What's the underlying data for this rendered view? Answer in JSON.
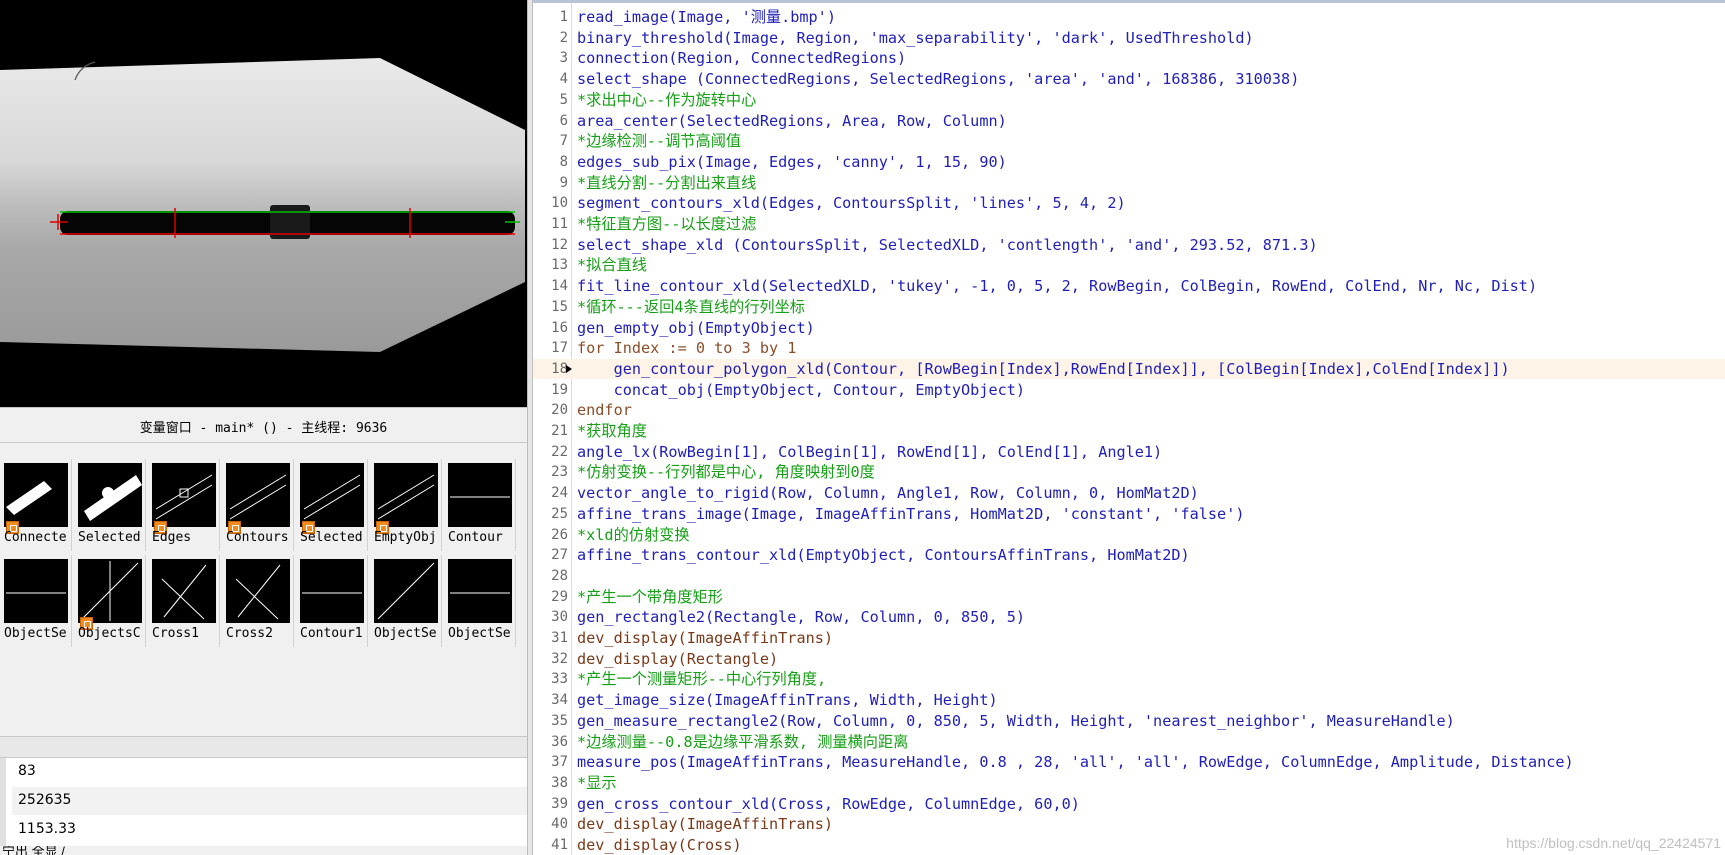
{
  "variable_window": {
    "title": "变量窗口 - main* () - 主线程: 9636",
    "iconic_row1": [
      {
        "label": "Connecte",
        "icon": "region-thumb-icon",
        "badge": true
      },
      {
        "label": "Selected",
        "icon": "region-thumb-icon",
        "badge": false
      },
      {
        "label": "Edges",
        "icon": "edges-thumb-icon",
        "badge": true
      },
      {
        "label": "Contours",
        "icon": "contours-thumb-icon",
        "badge": true
      },
      {
        "label": "Selected",
        "icon": "contours-thumb-icon",
        "badge": true
      },
      {
        "label": "EmptyObj",
        "icon": "contours-thumb-icon",
        "badge": true
      },
      {
        "label": "Contour",
        "icon": "line-thumb-icon",
        "badge": false
      }
    ],
    "iconic_row2": [
      {
        "label": "ObjectSe",
        "icon": "cross-line-thumb-icon",
        "badge": false
      },
      {
        "label": "ObjectsC",
        "icon": "line-thumb-icon",
        "badge": true
      },
      {
        "label": "Cross1",
        "icon": "cross-thumb-icon",
        "badge": false
      },
      {
        "label": "Cross2",
        "icon": "cross-thumb-icon",
        "badge": false
      },
      {
        "label": "Contour1",
        "icon": "line-thumb-icon",
        "badge": false
      },
      {
        "label": "ObjectSe",
        "icon": "line-thumb-icon",
        "badge": false
      },
      {
        "label": "ObjectSe",
        "icon": "line-thumb-icon",
        "badge": false
      }
    ],
    "values": [
      "83",
      "252635",
      "1153.33"
    ],
    "status_text": "宁出  全显 /"
  },
  "code_lines": [
    {
      "n": "1",
      "t": "read_image(Image, '测量.bmp')",
      "k": "op"
    },
    {
      "n": "2",
      "t": "binary_threshold(Image, Region, 'max_separability', 'dark', UsedThreshold)",
      "k": "op"
    },
    {
      "n": "3",
      "t": "connection(Region, ConnectedRegions)",
      "k": "op"
    },
    {
      "n": "4",
      "t": "select_shape (ConnectedRegions, SelectedRegions, 'area', 'and', 168386, 310038)",
      "k": "op"
    },
    {
      "n": "5",
      "t": "*求出中心--作为旋转中心",
      "k": "cm"
    },
    {
      "n": "6",
      "t": "area_center(SelectedRegions, Area, Row, Column)",
      "k": "op"
    },
    {
      "n": "7",
      "t": "*边缘检测--调节高阈值",
      "k": "cm"
    },
    {
      "n": "8",
      "t": "edges_sub_pix(Image, Edges, 'canny', 1, 15, 90)",
      "k": "op"
    },
    {
      "n": "9",
      "t": "*直线分割--分割出来直线",
      "k": "cm"
    },
    {
      "n": "10",
      "t": "segment_contours_xld(Edges, ContoursSplit, 'lines', 5, 4, 2)",
      "k": "op"
    },
    {
      "n": "11",
      "t": "*特征直方图--以长度过滤",
      "k": "cm"
    },
    {
      "n": "12",
      "t": "select_shape_xld (ContoursSplit, SelectedXLD, 'contlength', 'and', 293.52, 871.3)",
      "k": "op"
    },
    {
      "n": "13",
      "t": "*拟合直线",
      "k": "cm"
    },
    {
      "n": "14",
      "t": "fit_line_contour_xld(SelectedXLD, 'tukey', -1, 0, 5, 2, RowBegin, ColBegin, RowEnd, ColEnd, Nr, Nc, Dist)",
      "k": "op"
    },
    {
      "n": "15",
      "t": "*循环---返回4条直线的行列坐标",
      "k": "cm"
    },
    {
      "n": "16",
      "t": "gen_empty_obj(EmptyObject)",
      "k": "op"
    },
    {
      "n": "17",
      "t": "for Index := 0 to 3 by 1",
      "k": "ctl"
    },
    {
      "n": "18",
      "t": "    gen_contour_polygon_xld(Contour, [RowBegin[Index],RowEnd[Index]], [ColBegin[Index],ColEnd[Index]])",
      "k": "op"
    },
    {
      "n": "19",
      "t": "    concat_obj(EmptyObject, Contour, EmptyObject)",
      "k": "op"
    },
    {
      "n": "20",
      "t": "endfor",
      "k": "ctl"
    },
    {
      "n": "21",
      "t": "*获取角度",
      "k": "cm"
    },
    {
      "n": "22",
      "t": "angle_lx(RowBegin[1], ColBegin[1], RowEnd[1], ColEnd[1], Angle1)",
      "k": "op"
    },
    {
      "n": "23",
      "t": "*仿射变换--行列都是中心, 角度映射到0度",
      "k": "cm"
    },
    {
      "n": "24",
      "t": "vector_angle_to_rigid(Row, Column, Angle1, Row, Column, 0, HomMat2D)",
      "k": "op"
    },
    {
      "n": "25",
      "t": "affine_trans_image(Image, ImageAffinTrans, HomMat2D, 'constant', 'false')",
      "k": "op"
    },
    {
      "n": "26",
      "t": "*xld的仿射变换",
      "k": "cm"
    },
    {
      "n": "27",
      "t": "affine_trans_contour_xld(EmptyObject, ContoursAffinTrans, HomMat2D)",
      "k": "op"
    },
    {
      "n": "28",
      "t": "",
      "k": "op"
    },
    {
      "n": "29",
      "t": "*产生一个带角度矩形",
      "k": "cm"
    },
    {
      "n": "30",
      "t": "gen_rectangle2(Rectangle, Row, Column, 0, 850, 5)",
      "k": "op"
    },
    {
      "n": "31",
      "t": "dev_display(ImageAffinTrans)",
      "k": "dev"
    },
    {
      "n": "32",
      "t": "dev_display(Rectangle)",
      "k": "dev"
    },
    {
      "n": "33",
      "t": "*产生一个测量矩形--中心行列角度,",
      "k": "cm"
    },
    {
      "n": "34",
      "t": "get_image_size(ImageAffinTrans, Width, Height)",
      "k": "op"
    },
    {
      "n": "35",
      "t": "gen_measure_rectangle2(Row, Column, 0, 850, 5, Width, Height, 'nearest_neighbor', MeasureHandle)",
      "k": "op"
    },
    {
      "n": "36",
      "t": "*边缘测量--0.8是边缘平滑系数, 测量横向距离",
      "k": "cm"
    },
    {
      "n": "37",
      "t": "measure_pos(ImageAffinTrans, MeasureHandle, 0.8 , 28, 'all', 'all', RowEdge, ColumnEdge, Amplitude, Distance)",
      "k": "op"
    },
    {
      "n": "38",
      "t": "*显示",
      "k": "cm"
    },
    {
      "n": "39",
      "t": "gen_cross_contour_xld(Cross, RowEdge, ColumnEdge, 60,0)",
      "k": "op"
    },
    {
      "n": "40",
      "t": "dev_display(ImageAffinTrans)",
      "k": "dev"
    },
    {
      "n": "41",
      "t": "dev_display(Cross)",
      "k": "dev"
    }
  ],
  "current_line": "18",
  "watermark": "https://blog.csdn.net/qq_22424571",
  "colors": {
    "operator": "#1f1fb8",
    "comment": "#16a016",
    "control": "#8a4f2a",
    "badge": "#f08b1d",
    "measure_line": "#00c000",
    "measure_cross": "#e00000"
  }
}
